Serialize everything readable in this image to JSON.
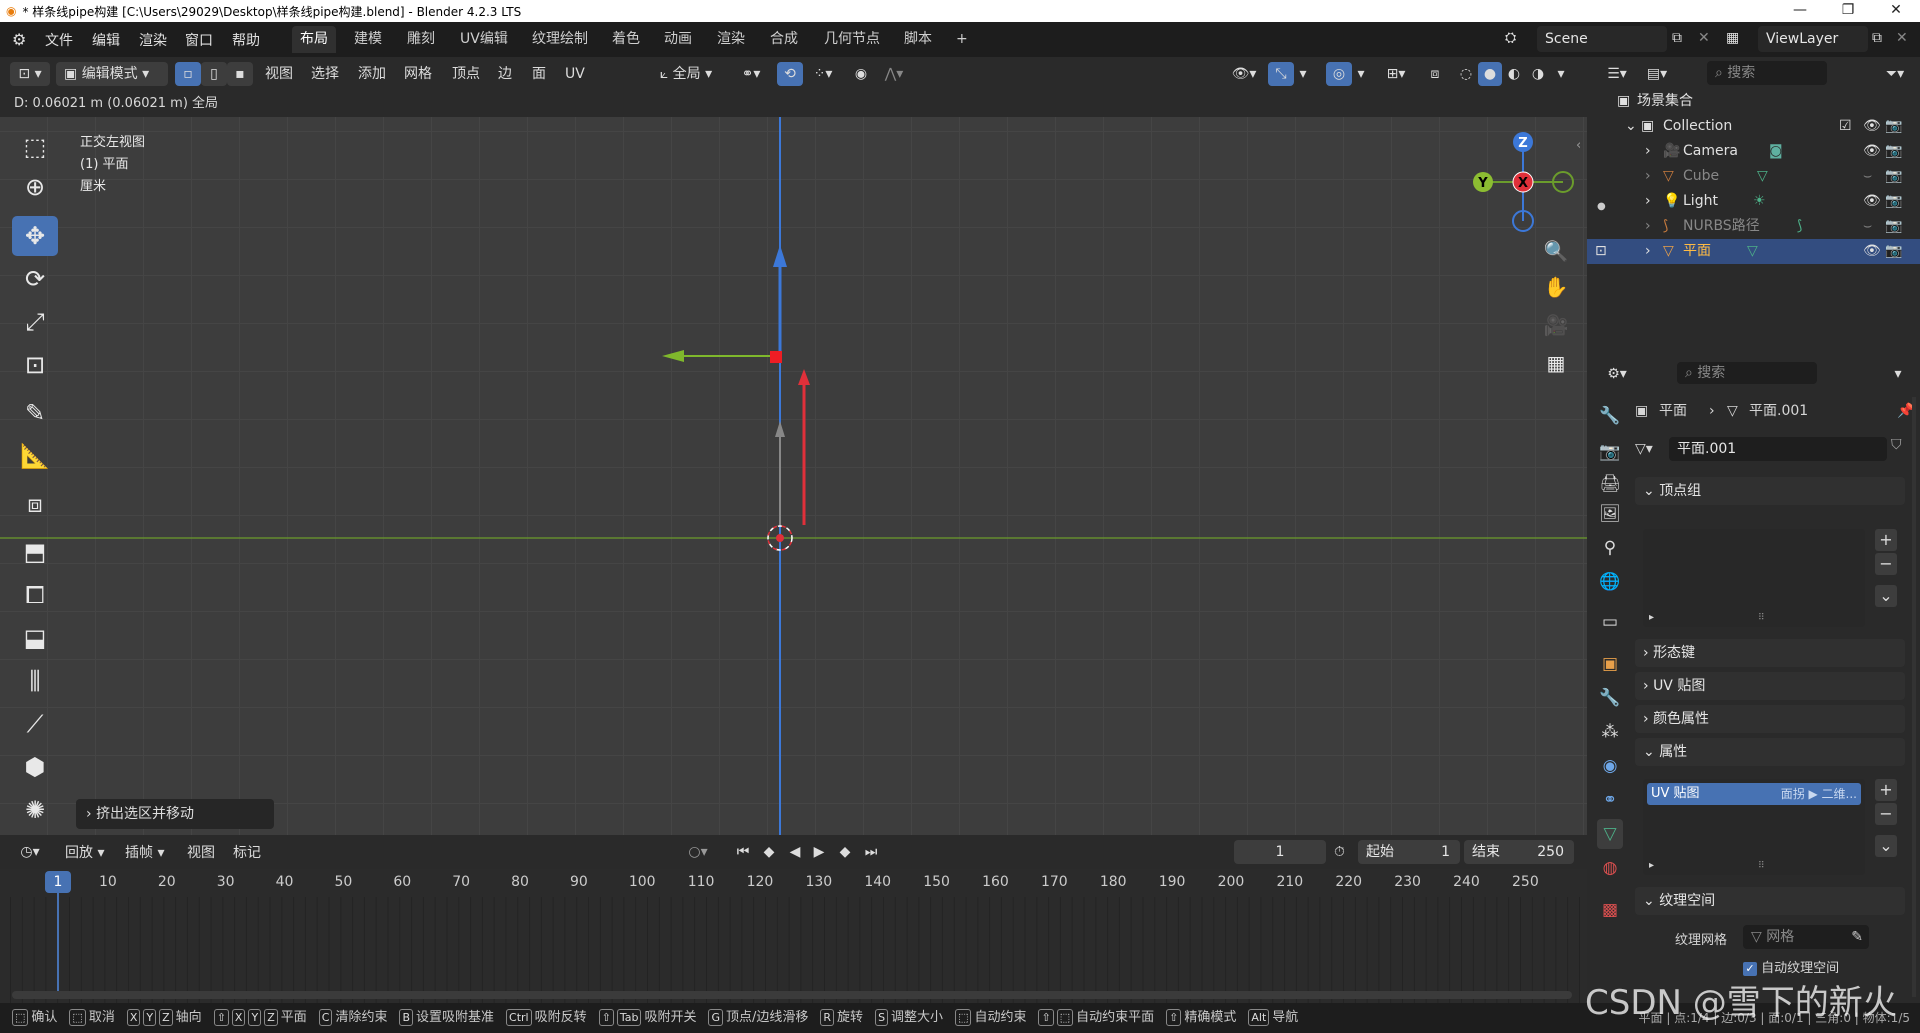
{
  "titlebar": {
    "title": "* 样条线pipe构建 [C:\\Users\\29029\\Desktop\\样条线pipe构建.blend] - Blender 4.2.3 LTS",
    "min": "—",
    "max": "❐",
    "close": "✕"
  },
  "menu": [
    "文件",
    "编辑",
    "渲染",
    "窗口",
    "帮助"
  ],
  "workspaces": [
    "布局",
    "建模",
    "雕刻",
    "UV编辑",
    "纹理绘制",
    "着色",
    "动画",
    "渲染",
    "合成",
    "几何节点",
    "脚本"
  ],
  "workspace_add": "+",
  "scene": "Scene",
  "viewlayer": "ViewLayer",
  "header3d": {
    "mode": "编辑模式",
    "menus": [
      "视图",
      "选择",
      "添加",
      "网格",
      "顶点",
      "边",
      "面",
      "UV"
    ],
    "orientation": "全局"
  },
  "operator_info": "D: 0.06021 m (0.06021 m) 全局",
  "viewport": {
    "view_name": "正交左视图",
    "object": "(1) 平面",
    "units": "厘米",
    "last_op": "挤出选区并移动"
  },
  "gizmo": {
    "z": "Z",
    "y": "Y",
    "x": "X"
  },
  "timeline": {
    "menus": [
      "回放",
      "插帧",
      "视图",
      "标记"
    ],
    "current_frame": "1",
    "start_label": "起始",
    "start": "1",
    "end_label": "结束",
    "end": "250",
    "ticks": [
      "1",
      "10",
      "20",
      "30",
      "40",
      "50",
      "60",
      "70",
      "80",
      "90",
      "100",
      "110",
      "120",
      "130",
      "140",
      "150",
      "160",
      "170",
      "180",
      "190",
      "200",
      "210",
      "220",
      "230",
      "240",
      "250"
    ]
  },
  "statusbar": {
    "items": [
      {
        "keys": [
          "⬚"
        ],
        "label": "确认"
      },
      {
        "keys": [
          "⬚"
        ],
        "label": "取消"
      },
      {
        "keys": [
          "X",
          "Y",
          "Z"
        ],
        "label": "轴向"
      },
      {
        "keys": [
          "⇧",
          "X",
          "Y",
          "Z"
        ],
        "label": "平面"
      },
      {
        "keys": [
          "C"
        ],
        "label": "清除约束"
      },
      {
        "keys": [
          "B"
        ],
        "label": "设置吸附基准"
      },
      {
        "keys": [
          "Ctrl"
        ],
        "label": "吸附反转"
      },
      {
        "keys": [
          "⇧",
          "Tab"
        ],
        "label": "吸附开关"
      },
      {
        "keys": [
          "G"
        ],
        "label": "顶点/边线滑移"
      },
      {
        "keys": [
          "R"
        ],
        "label": "旋转"
      },
      {
        "keys": [
          "S"
        ],
        "label": "调整大小"
      },
      {
        "keys": [
          "⬚"
        ],
        "label": "自动约束"
      },
      {
        "keys": [
          "⇧",
          "⬚"
        ],
        "label": "自动约束平面"
      },
      {
        "keys": [
          "⇧"
        ],
        "label": "精确模式"
      },
      {
        "keys": [
          "Alt"
        ],
        "label": "导航"
      }
    ],
    "stats": "平面 | 点:1/4 | 边:0/3 | 面:0/1 | 三角:0 | 物体:1/5"
  },
  "outliner": {
    "search_placeholder": "搜索",
    "root": "场景集合",
    "collection": "Collection",
    "items": [
      "Camera",
      "Cube",
      "Light",
      "NURBS路径",
      "平面"
    ]
  },
  "properties": {
    "search_placeholder": "搜索",
    "breadcrumb_obj": "平面",
    "breadcrumb_sep": "›",
    "breadcrumb_mesh": "平面.001",
    "mesh_name": "平面.001",
    "panels": {
      "vertex_groups": "顶点组",
      "shape_keys": "形态键",
      "uv_maps": "UV 贴图",
      "color_attrs": "颜色属性",
      "attributes": "属性",
      "texture_space": "纹理空间"
    },
    "attr_item": "UV 贴图",
    "attr_item_info": "面拐 ▶ 二维...",
    "texture_mesh_label": "纹理网格",
    "texture_mesh_placeholder": "网格",
    "auto_texspace": "自动纹理空间"
  },
  "watermark": "CSDN @雪下的新火",
  "colors": {
    "accent": "#4772b3",
    "axis_y": "#6b9c2c",
    "axis_z": "#3c78d8",
    "axis_x": "#e0303a",
    "selected_row": "#334d80"
  }
}
